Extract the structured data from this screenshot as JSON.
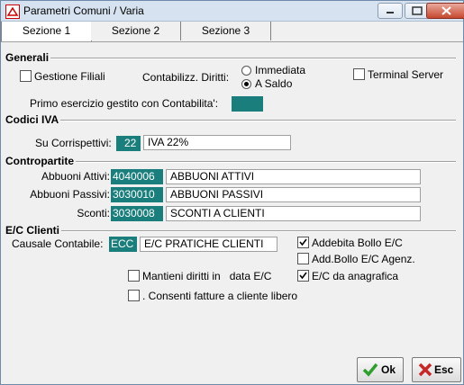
{
  "window": {
    "title": "Parametri Comuni / Varia"
  },
  "tabs": [
    "Sezione 1",
    "Sezione 2",
    "Sezione 3"
  ],
  "generali": {
    "title": "Generali",
    "gestione_filiali": {
      "label": "Gestione Filiali",
      "checked": false
    },
    "contab_diritti_label": "Contabilizz. Diritti:",
    "radio_immediata": {
      "label": "Immediata",
      "selected": false
    },
    "radio_saldo": {
      "label": "A Saldo",
      "selected": true
    },
    "terminal_server": {
      "label": "Terminal Server",
      "checked": false
    },
    "primo_esercizio_label": "Primo esercizio gestito con Contabilita':",
    "primo_esercizio_value": ""
  },
  "iva": {
    "title": "Codici IVA",
    "corrispettivi_label": "Su Corrispettivi:",
    "corrispettivi_code": "22",
    "corrispettivi_desc": "IVA 22%"
  },
  "contropartite": {
    "title": "Contropartite",
    "rows": [
      {
        "label": "Abbuoni Attivi:",
        "code": "4040006",
        "desc": "ABBUONI ATTIVI"
      },
      {
        "label": "Abbuoni Passivi:",
        "code": "3030010",
        "desc": "ABBUONI PASSIVI"
      },
      {
        "label": "Sconti:",
        "code": "3030008",
        "desc": "SCONTI A CLIENTI"
      }
    ]
  },
  "ec": {
    "title": "E/C Clienti",
    "causale_label": "Causale Contabile:",
    "causale_code": "ECC",
    "causale_desc": "E/C PRATICHE CLIENTI",
    "addebita_bollo": {
      "label": "Addebita Bollo E/C",
      "checked": true
    },
    "add_bollo_agenz": {
      "label": "Add.Bollo E/C Agenz.",
      "checked": false
    },
    "mantieni": {
      "label": "Mantieni diritti in   data E/C",
      "checked": false
    },
    "da_anagrafica": {
      "label": "E/C da anagrafica",
      "checked": true
    },
    "consenti": {
      "label": ". Consenti fatture a cliente libero",
      "checked": false
    }
  },
  "buttons": {
    "ok": "Ok",
    "esc": "Esc"
  },
  "colors": {
    "code_bg": "#1a7e7c",
    "ok_icon": "#2e9e2e",
    "esc_icon": "#c62828"
  }
}
